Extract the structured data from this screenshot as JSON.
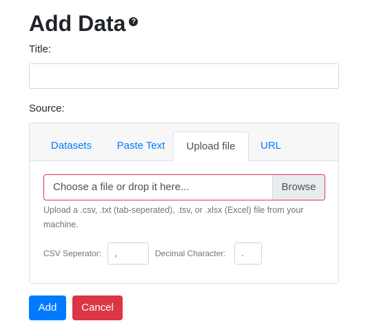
{
  "page": {
    "heading": "Add Data",
    "help_icon_glyph": "?",
    "title_label": "Title:",
    "title_value": "",
    "source_label": "Source:"
  },
  "tabs": [
    {
      "label": "Datasets",
      "active": false
    },
    {
      "label": "Paste Text",
      "active": false
    },
    {
      "label": "Upload file",
      "active": true
    },
    {
      "label": "URL",
      "active": false
    }
  ],
  "upload": {
    "placeholder": "Choose a file or drop it here...",
    "browse_label": "Browse",
    "help_text": "Upload a .csv, .txt (tab-seperated), .tsv, or .xlsx (Excel) file from your machine.",
    "csv_separator_label": "CSV Seperator:",
    "csv_separator_value": ",",
    "decimal_label": "Decimal Character:",
    "decimal_value": "."
  },
  "actions": {
    "add_label": "Add",
    "cancel_label": "Cancel"
  },
  "colors": {
    "primary": "#007bff",
    "danger": "#dc3545",
    "text": "#212529",
    "muted": "#6c757d"
  },
  "icons": {
    "help": "question-circle-icon"
  }
}
